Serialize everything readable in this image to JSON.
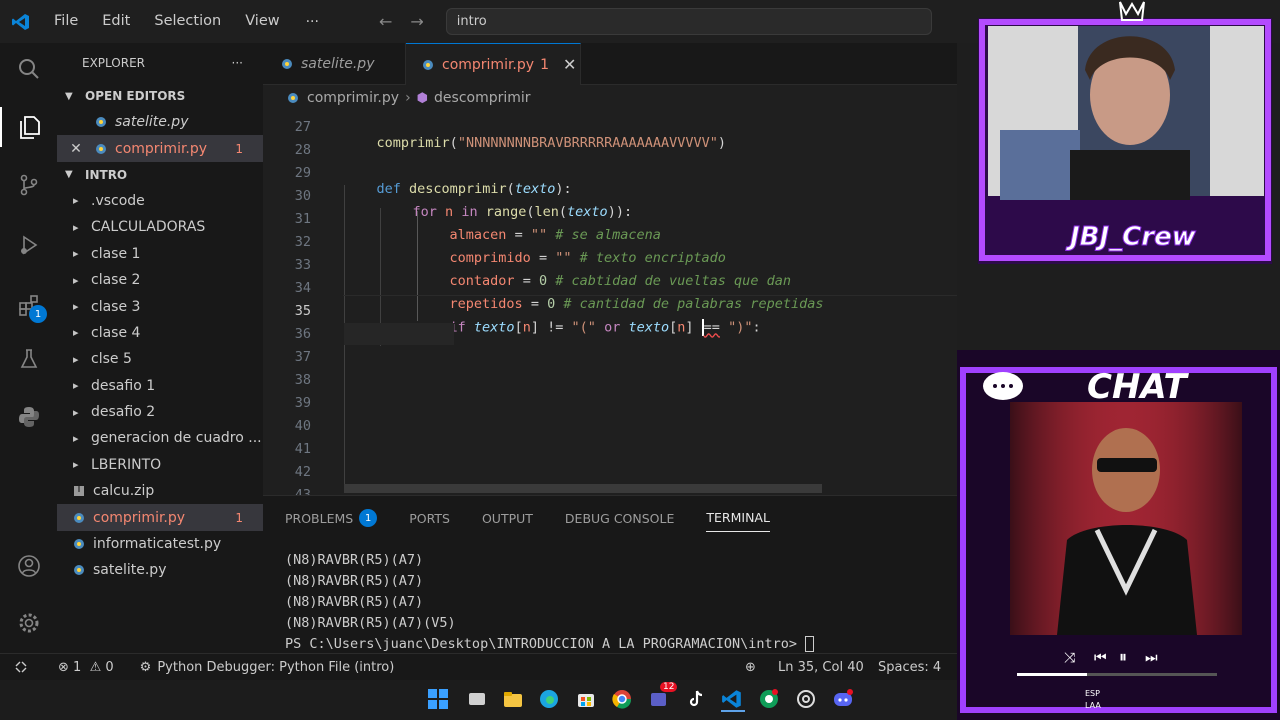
{
  "titlebar": {
    "menu": [
      "File",
      "Edit",
      "Selection",
      "View"
    ],
    "more": "···",
    "search_text": "intro"
  },
  "activitybar": {
    "extensions_badge": "1"
  },
  "sidebar": {
    "title": "EXPLORER",
    "more": "···",
    "open_editors_label": "OPEN EDITORS",
    "open_editors": [
      {
        "name": "satelite.py",
        "count": ""
      },
      {
        "name": "comprimir.py",
        "count": "1"
      }
    ],
    "folder_label": "INTRO",
    "items": [
      {
        "name": ".vscode",
        "type": "folder"
      },
      {
        "name": "CALCULADORAS",
        "type": "folder"
      },
      {
        "name": "clase 1",
        "type": "folder"
      },
      {
        "name": "clase 2",
        "type": "folder"
      },
      {
        "name": "clase 3",
        "type": "folder"
      },
      {
        "name": "clase 4",
        "type": "folder"
      },
      {
        "name": "clse 5",
        "type": "folder"
      },
      {
        "name": "desafio 1",
        "type": "folder"
      },
      {
        "name": "desafio 2",
        "type": "folder"
      },
      {
        "name": "generacion de cuadro ...",
        "type": "folder"
      },
      {
        "name": "LBERINTO",
        "type": "folder"
      },
      {
        "name": "calcu.zip",
        "type": "zip"
      },
      {
        "name": "comprimir.py",
        "type": "py",
        "count": "1"
      },
      {
        "name": "informaticatest.py",
        "type": "py"
      },
      {
        "name": "satelite.py",
        "type": "py"
      }
    ]
  },
  "tabs": [
    {
      "name": "satelite.py",
      "count": ""
    },
    {
      "name": "comprimir.py",
      "count": "1"
    }
  ],
  "breadcrumb": {
    "file": "comprimir.py",
    "symbol": "descomprimir"
  },
  "editor": {
    "line_numbers": [
      "27",
      "28",
      "29",
      "30",
      "31",
      "32",
      "33",
      "34",
      "35",
      "36",
      "37",
      "38",
      "39",
      "40",
      "41",
      "42",
      "43"
    ],
    "current_line": "35",
    "code": {
      "l27_fn": "comprimir",
      "l27_arg": "\"NNNNNNNNBRAVBRRRRRAAAAAAAVVVVV\"",
      "l29_def": "def",
      "l29_name": "descomprimir",
      "l29_param": "texto",
      "l30_for": "for",
      "l30_var": "n",
      "l30_in": "in",
      "l30_range": "range",
      "l30_len": "len",
      "l30_arg": "texto",
      "l31_var": "almacen",
      "l31_val": "\"\"",
      "l31_cmt": "# se almacena",
      "l32_var": "comprimido",
      "l32_val": "\"\"",
      "l32_cmt": "# texto encriptado",
      "l33_var": "contador",
      "l33_val": "0",
      "l33_cmt": "# cabtidad de vueltas que dan",
      "l34_var": "repetidos",
      "l34_val": "0",
      "l34_cmt": "# cantidad de palabras repetidas",
      "l35_if": "if",
      "l35_t1": "texto",
      "l35_i1": "n",
      "l35_s1": "\"(\"",
      "l35_or": "or",
      "l35_t2": "texto",
      "l35_i2": "n",
      "l35_s2": "\")\""
    }
  },
  "panel": {
    "tabs": [
      "PROBLEMS",
      "PORTS",
      "OUTPUT",
      "DEBUG CONSOLE",
      "TERMINAL"
    ],
    "problems_count": "1",
    "terminal_lines": [
      "(N8)RAVBR(R5)(A7)",
      "(N8)RAVBR(R5)(A7)",
      "(N8)RAVBR(R5)(A7)",
      "(N8)RAVBR(R5)(A7)(V5)"
    ],
    "prompt": "PS C:\\Users\\juanc\\Desktop\\INTRODUCCION A LA PROGRAMACION\\intro> "
  },
  "statusbar": {
    "errors": "1",
    "warnings": "0",
    "debugger": "Python Debugger: Python File (intro)",
    "position": "Ln 35, Col 40",
    "spaces": "Spaces: 4"
  },
  "overlay": {
    "crew_text": "JBJ_Crew",
    "chat_text": "CHAT",
    "taskbar_badge": "12",
    "tray_label_1": "ESP",
    "tray_label_2": "LAA"
  },
  "colors": {
    "accent": "#0078d4",
    "error": "#f48771",
    "overlay_purple": "#8a2be2"
  }
}
